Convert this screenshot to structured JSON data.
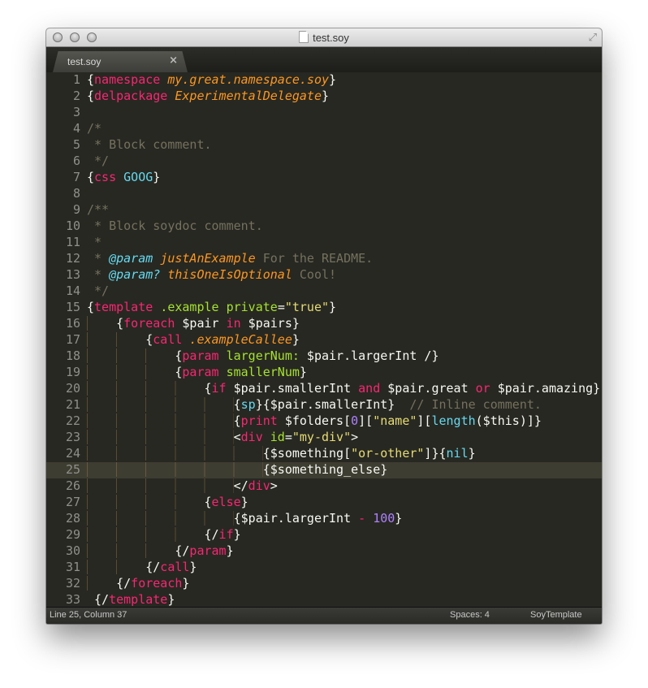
{
  "window": {
    "title": "test.soy",
    "icons": [
      "close-light",
      "minimize-light",
      "zoom-light",
      "document-icon",
      "fullscreen-icon"
    ]
  },
  "tab": {
    "label": "test.soy",
    "close": "×"
  },
  "highlighted_line": 25,
  "colors": {
    "background": "#272822",
    "foreground": "#f8f8f2",
    "keyword": "#f92672",
    "entity": "#fd971f",
    "comment": "#75715e",
    "support": "#66d9ef",
    "attribute": "#a6e22e",
    "string": "#e6db74",
    "number": "#ae81ff",
    "line_highlight": "#3e3d32"
  },
  "lines": [
    [
      [
        "{",
        "f"
      ],
      [
        "namespace",
        "k"
      ],
      [
        " ",
        "f"
      ],
      [
        "my.great.namespace.soy",
        "o"
      ],
      [
        "}",
        "f"
      ]
    ],
    [
      [
        "{",
        "f"
      ],
      [
        "delpackage",
        "k"
      ],
      [
        " ",
        "f"
      ],
      [
        "ExperimentalDelegate",
        "o"
      ],
      [
        "}",
        "f"
      ]
    ],
    [],
    [
      [
        "/*",
        "c"
      ]
    ],
    [
      [
        " * Block comment.",
        "c"
      ]
    ],
    [
      [
        " */",
        "c"
      ]
    ],
    [
      [
        "{",
        "f"
      ],
      [
        "css",
        "k"
      ],
      [
        " ",
        "f"
      ],
      [
        "GOOG",
        "b"
      ],
      [
        "}",
        "f"
      ]
    ],
    [],
    [
      [
        "/**",
        "c"
      ]
    ],
    [
      [
        " * Block soydoc comment.",
        "c"
      ]
    ],
    [
      [
        " *",
        "c"
      ]
    ],
    [
      [
        " * ",
        "c"
      ],
      [
        "@param",
        "bi"
      ],
      [
        " ",
        "f"
      ],
      [
        "justAnExample",
        "o"
      ],
      [
        " For the README.",
        "c"
      ]
    ],
    [
      [
        " * ",
        "c"
      ],
      [
        "@param?",
        "bi"
      ],
      [
        " ",
        "f"
      ],
      [
        "thisOneIsOptional",
        "o"
      ],
      [
        " Cool!",
        "c"
      ]
    ],
    [
      [
        " */",
        "c"
      ]
    ],
    [
      [
        "{",
        "f"
      ],
      [
        "template",
        "k"
      ],
      [
        " ",
        "f"
      ],
      [
        ".example",
        "g"
      ],
      [
        " ",
        "f"
      ],
      [
        "private",
        "g"
      ],
      [
        "=",
        "f"
      ],
      [
        "\"true\"",
        "y"
      ],
      [
        "}",
        "f"
      ]
    ],
    [
      [
        "    ",
        "ws"
      ],
      [
        "{",
        "f"
      ],
      [
        "foreach",
        "k"
      ],
      [
        " $pair ",
        "f"
      ],
      [
        "in",
        "k"
      ],
      [
        " $pairs}",
        "f"
      ]
    ],
    [
      [
        "        ",
        "ws"
      ],
      [
        "{",
        "f"
      ],
      [
        "call",
        "k"
      ],
      [
        " ",
        "f"
      ],
      [
        ".exampleCallee",
        "o"
      ],
      [
        "}",
        "f"
      ]
    ],
    [
      [
        "            ",
        "ws"
      ],
      [
        "{",
        "f"
      ],
      [
        "param",
        "k"
      ],
      [
        " ",
        "f"
      ],
      [
        "largerNum:",
        "g"
      ],
      [
        " $pair.largerInt /}",
        "f"
      ]
    ],
    [
      [
        "            ",
        "ws"
      ],
      [
        "{",
        "f"
      ],
      [
        "param",
        "k"
      ],
      [
        " ",
        "f"
      ],
      [
        "smallerNum",
        "g"
      ],
      [
        "}",
        "f"
      ]
    ],
    [
      [
        "                ",
        "ws"
      ],
      [
        "{",
        "f"
      ],
      [
        "if",
        "k"
      ],
      [
        " $pair.smallerInt ",
        "f"
      ],
      [
        "and",
        "k"
      ],
      [
        " $pair.great ",
        "f"
      ],
      [
        "or",
        "k"
      ],
      [
        " $pair.amazing}",
        "f"
      ]
    ],
    [
      [
        "                    ",
        "ws"
      ],
      [
        "{",
        "f"
      ],
      [
        "sp",
        "b"
      ],
      [
        "}{$pair.smallerInt}  ",
        "f"
      ],
      [
        "// Inline comment.",
        "c"
      ]
    ],
    [
      [
        "                    ",
        "ws"
      ],
      [
        "{",
        "f"
      ],
      [
        "print",
        "k"
      ],
      [
        " $folders[",
        "f"
      ],
      [
        "0",
        "p"
      ],
      [
        "][",
        "f"
      ],
      [
        "\"name\"",
        "y"
      ],
      [
        "][",
        "f"
      ],
      [
        "length",
        "b"
      ],
      [
        "($this)]}",
        "f"
      ]
    ],
    [
      [
        "                    ",
        "ws"
      ],
      [
        "<",
        "f"
      ],
      [
        "div",
        "k"
      ],
      [
        " ",
        "f"
      ],
      [
        "id",
        "g"
      ],
      [
        "=",
        "f"
      ],
      [
        "\"my-div\"",
        "y"
      ],
      [
        ">",
        "f"
      ]
    ],
    [
      [
        "                        ",
        "ws"
      ],
      [
        "{$something[",
        "f"
      ],
      [
        "\"or-other\"",
        "y"
      ],
      [
        "]}{",
        "f"
      ],
      [
        "nil",
        "b"
      ],
      [
        "}",
        "f"
      ]
    ],
    [
      [
        "                        ",
        "ws"
      ],
      [
        "{$something_else}",
        "f"
      ]
    ],
    [
      [
        "                    ",
        "ws"
      ],
      [
        "</",
        "f"
      ],
      [
        "div",
        "k"
      ],
      [
        ">",
        "f"
      ]
    ],
    [
      [
        "                ",
        "ws"
      ],
      [
        "{",
        "f"
      ],
      [
        "else",
        "k"
      ],
      [
        "}",
        "f"
      ]
    ],
    [
      [
        "                    ",
        "ws"
      ],
      [
        "{$pair.largerInt ",
        "f"
      ],
      [
        "-",
        "k"
      ],
      [
        " ",
        "f"
      ],
      [
        "100",
        "p"
      ],
      [
        "}",
        "f"
      ]
    ],
    [
      [
        "                ",
        "ws"
      ],
      [
        "{/",
        "f"
      ],
      [
        "if",
        "k"
      ],
      [
        "}",
        "f"
      ]
    ],
    [
      [
        "            ",
        "ws"
      ],
      [
        "{/",
        "f"
      ],
      [
        "param",
        "k"
      ],
      [
        "}",
        "f"
      ]
    ],
    [
      [
        "        ",
        "ws"
      ],
      [
        "{/",
        "f"
      ],
      [
        "call",
        "k"
      ],
      [
        "}",
        "f"
      ]
    ],
    [
      [
        "    ",
        "ws"
      ],
      [
        "{/",
        "f"
      ],
      [
        "foreach",
        "k"
      ],
      [
        "}",
        "f"
      ]
    ],
    [
      [
        " {/",
        "f"
      ],
      [
        "template",
        "k"
      ],
      [
        "}",
        "f"
      ]
    ]
  ],
  "status": {
    "position": "Line 25, Column 37",
    "indentation": "Spaces: 4",
    "syntax": "SoyTemplate"
  }
}
